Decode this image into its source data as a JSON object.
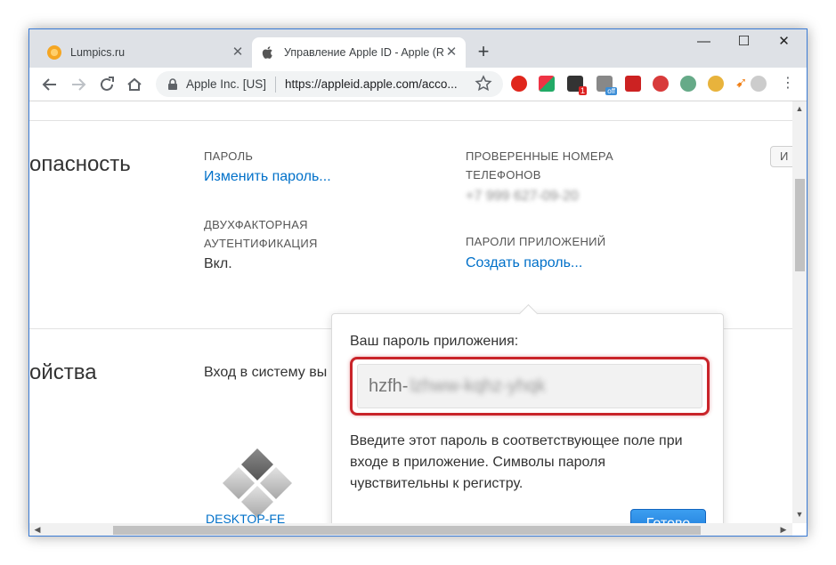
{
  "tabs": [
    {
      "title": "Lumpics.ru",
      "active": false
    },
    {
      "title": "Управление Apple ID - Apple (R",
      "active": true
    }
  ],
  "address": {
    "org": "Apple Inc. [US]",
    "url": "https://appleid.apple.com/acco..."
  },
  "security": {
    "heading": "опасность",
    "password_label": "ПАРОЛЬ",
    "change_password": "Изменить пароль...",
    "twofa_label_1": "ДВУХФАКТОРНАЯ",
    "twofa_label_2": "АУТЕНТИФИКАЦИЯ",
    "twofa_value": "Вкл.",
    "phones_label_1": "ПРОВЕРЕННЫЕ НОМЕРА",
    "phones_label_2": "ТЕЛЕФОНОВ",
    "phone_value": "+7 999 627-09-20",
    "app_passwords_label": "ПАРОЛИ ПРИЛОЖЕНИЙ",
    "create_password": "Создать пароль...",
    "edit_btn": "И"
  },
  "devices": {
    "heading": "ойства",
    "signin_text": "Вход в систему вы",
    "device_name": "DESKTOP-FE"
  },
  "popover": {
    "title": "Ваш пароль приложения:",
    "password_visible": "hzfh-",
    "password_hidden": "lzhww-kqhz-yhqk",
    "description": "Введите этот пароль в соответствующее поле при входе в приложение. Символы пароля чувствительны к регистру.",
    "done": "Готово"
  },
  "colors": {
    "link": "#0070c9",
    "highlight": "#c9242a",
    "button": "#1a76d6"
  }
}
